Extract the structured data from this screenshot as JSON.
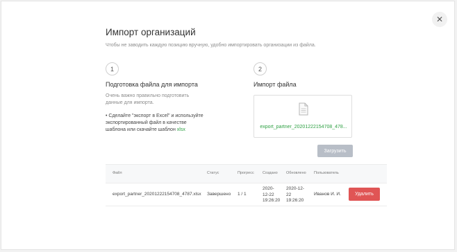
{
  "modal": {
    "close_symbol": "✕",
    "title": "Импорт организаций",
    "subtitle": "Чтобы не заводить каждую позицию вручную, удобно импортировать организации из файла."
  },
  "step1": {
    "number": "1",
    "title": "Подготовка файла для импорта",
    "description_lines": [
      "Очень важно правильно подготовить",
      "данные для импорта."
    ],
    "instruction_lines": [
      "• Сделайте \"экспорт в Excel\" и используйте",
      "экспортированный файл в качестве",
      "шаблона или скачайте шаблон"
    ],
    "template_link": "xlsx"
  },
  "step2": {
    "number": "2",
    "title": "Импорт файла",
    "file_name": "export_partner_20201222154708_478...",
    "upload_label": "Загрузить"
  },
  "table": {
    "headers": {
      "file": "Файл",
      "status": "Статус",
      "progress": "Прогресс",
      "created": "Создано",
      "updated": "Обновлено",
      "user": "Пользователь"
    },
    "rows": [
      {
        "file": "export_partner_20201222154708_4787.xlsx",
        "status": "Завершено",
        "progress": "1 / 1",
        "created": [
          "2020-",
          "12-22",
          "19:26:20"
        ],
        "updated": [
          "2020-12-",
          "22",
          "19:26:20"
        ],
        "user": "Иванов И. И.",
        "delete_label": "Удалить"
      }
    ]
  },
  "colors": {
    "accent_green": "#2ea043",
    "delete_red": "#e05555",
    "upload_disabled": "#b8bec7"
  },
  "icons": {
    "close": "close-icon",
    "file": "file-document-icon"
  }
}
